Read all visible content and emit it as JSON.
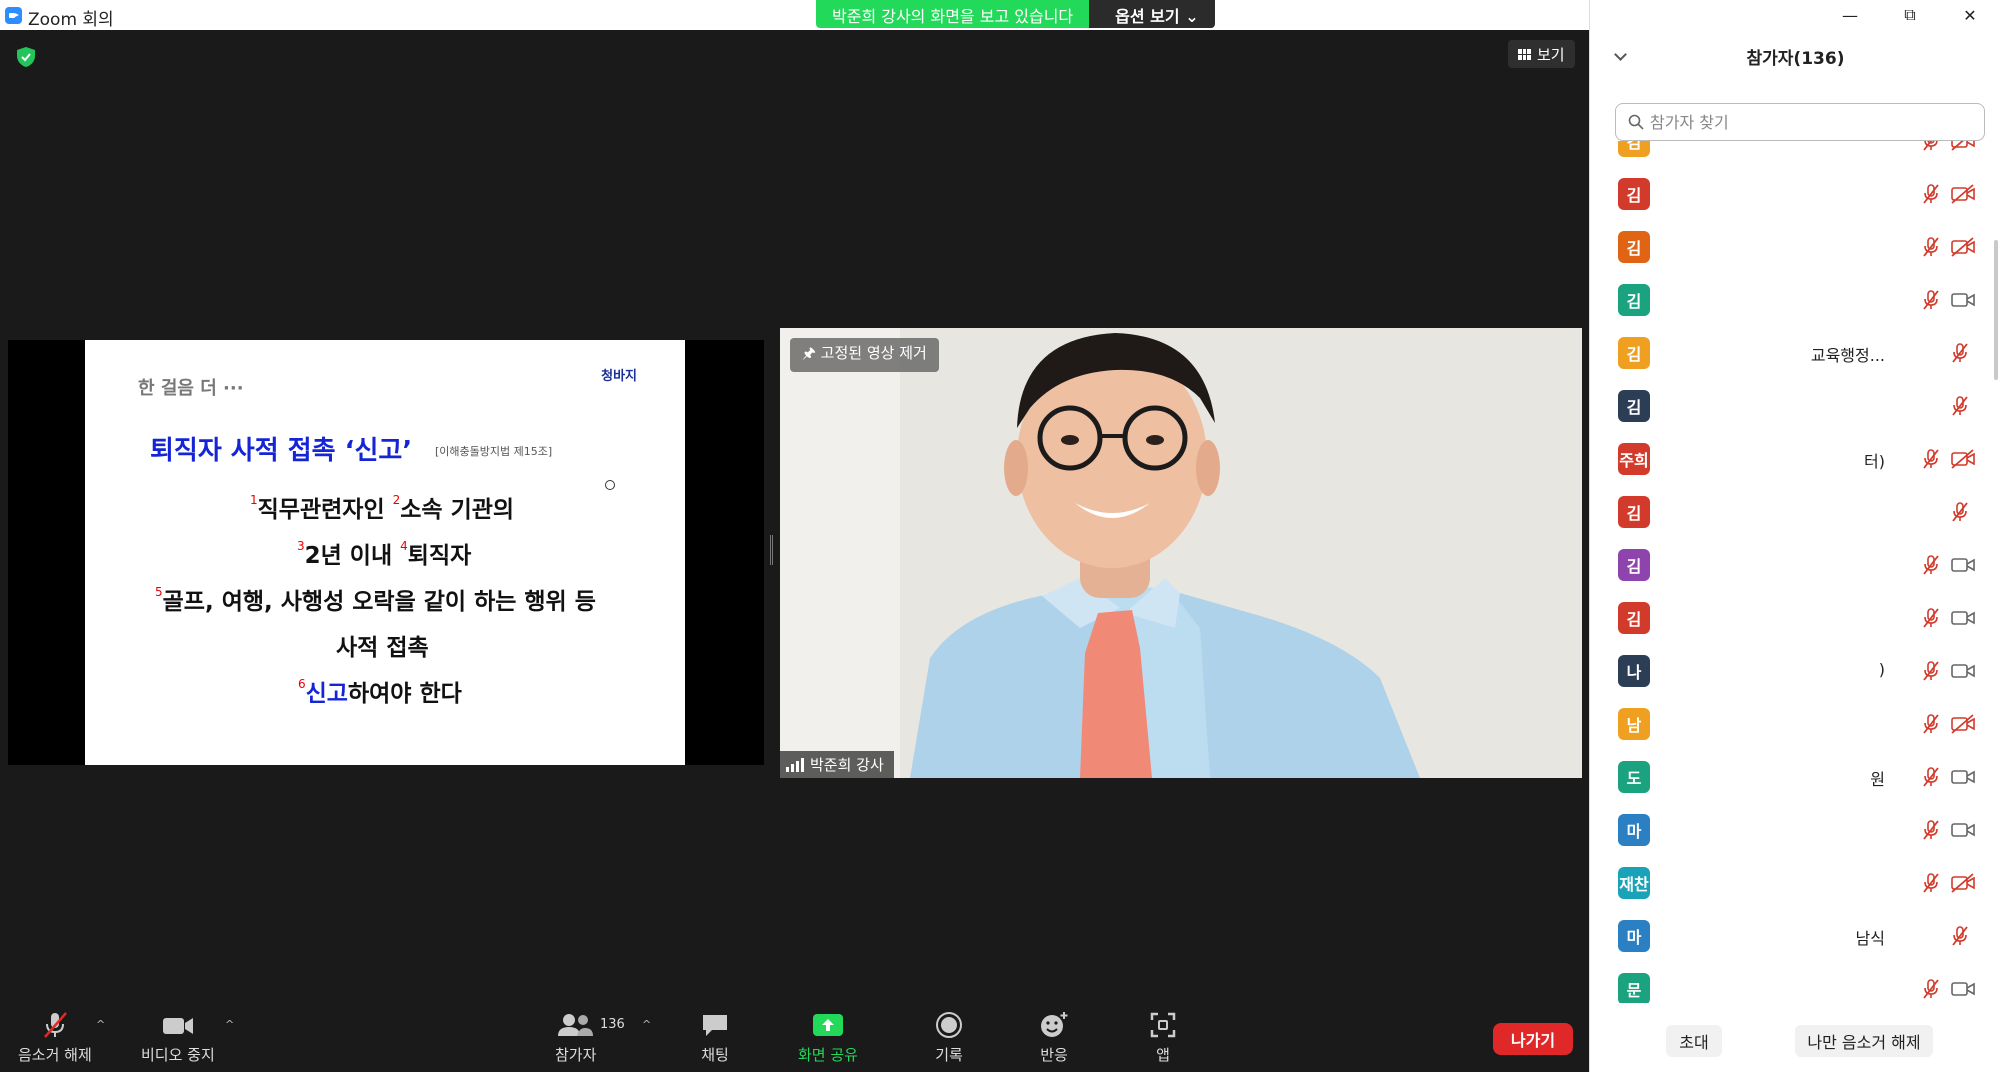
{
  "window": {
    "title": "Zoom 회의"
  },
  "banner": {
    "viewing": "박준희 강사의 화면을 보고 있습니다",
    "options": "옵션 보기"
  },
  "view": {
    "label": "보기"
  },
  "slide": {
    "header": "한 걸음 더 ···",
    "brand": "청바지",
    "title": "퇴직자 사적 접촉 ‘신고’",
    "law": "[이해충돌방지법 제15조]",
    "m1": "1",
    "m2": "2",
    "m3": "3",
    "m4": "4",
    "m5": "5",
    "m6": "6",
    "line1a": "직무관련자인 ",
    "line1b": "소속 기관의",
    "line2a": "2년 이내 ",
    "line2b": "퇴직자",
    "line3": "골프, 여행, 사행성 오락을 같이 하는 행위 등",
    "line4": "사적 접촉",
    "line5a": "신고",
    "line5b": "하여야 한다"
  },
  "video": {
    "pin_label": "고정된 영상 제거",
    "speaker": "박준희 강사"
  },
  "toolbar": {
    "mute": "음소거 해제",
    "video": "비디오 중지",
    "participants": "참가자",
    "participants_count": "136",
    "chat": "채팅",
    "share": "화면 공유",
    "record": "기록",
    "reactions": "반응",
    "apps": "앱",
    "leave": "나가기"
  },
  "panel": {
    "title": "참가자(136)",
    "search_placeholder": "참가자 찾기",
    "invite": "초대",
    "unmute_me": "나만 음소거 해제",
    "participants": [
      {
        "initial": "김",
        "color": "#f0a020",
        "name": "",
        "mic": "muted",
        "cam": "off"
      },
      {
        "initial": "김",
        "color": "#d23b2c",
        "name": "",
        "mic": "muted",
        "cam": "off"
      },
      {
        "initial": "김",
        "color": "#e06414",
        "name": "",
        "mic": "muted",
        "cam": "off"
      },
      {
        "initial": "김",
        "color": "#1aa37e",
        "name": "",
        "mic": "muted",
        "cam": "on"
      },
      {
        "initial": "김",
        "color": "#f0a020",
        "name": "교육행정...",
        "mic": "muted",
        "cam": "none"
      },
      {
        "initial": "김",
        "color": "#2c3e55",
        "name": "",
        "mic": "muted",
        "cam": "none"
      },
      {
        "initial": "주희",
        "color": "#d23b2c",
        "name": "터)",
        "mic": "muted",
        "cam": "off"
      },
      {
        "initial": "김",
        "color": "#d23b2c",
        "name": "",
        "mic": "muted",
        "cam": "none"
      },
      {
        "initial": "김",
        "color": "#8e44ad",
        "name": "",
        "mic": "muted",
        "cam": "on"
      },
      {
        "initial": "김",
        "color": "#d23b2c",
        "name": "",
        "mic": "muted",
        "cam": "on"
      },
      {
        "initial": "나",
        "color": "#2c3e55",
        "name": ")",
        "mic": "muted",
        "cam": "on"
      },
      {
        "initial": "남",
        "color": "#f0a020",
        "name": "",
        "mic": "muted",
        "cam": "off"
      },
      {
        "initial": "도",
        "color": "#1aa37e",
        "name": "원",
        "mic": "muted",
        "cam": "on"
      },
      {
        "initial": "마",
        "color": "#2b7fc3",
        "name": "",
        "mic": "muted",
        "cam": "on"
      },
      {
        "initial": "재찬",
        "color": "#1aa3b8",
        "name": "",
        "mic": "muted",
        "cam": "off"
      },
      {
        "initial": "마",
        "color": "#2b7fc3",
        "name": "남식",
        "mic": "muted",
        "cam": "none"
      },
      {
        "initial": "문",
        "color": "#1aa37e",
        "name": "",
        "mic": "muted",
        "cam": "on"
      }
    ]
  }
}
